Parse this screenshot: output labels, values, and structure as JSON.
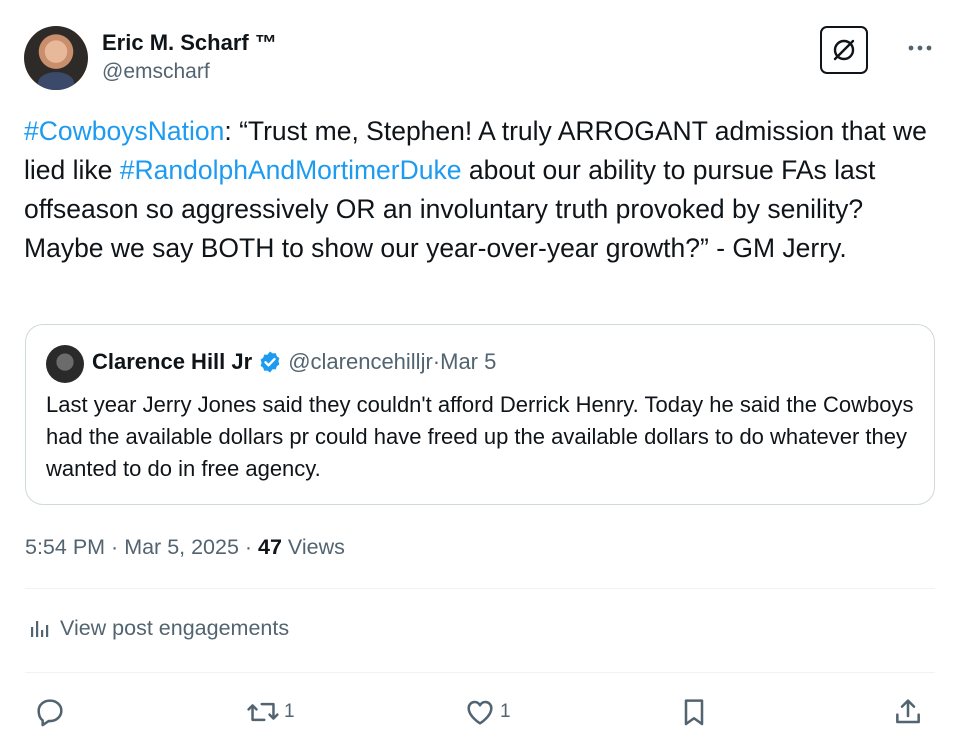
{
  "author": {
    "name": "Eric M. Scharf ™",
    "handle": "@emscharf"
  },
  "post": {
    "hashtag1": "#CowboysNation",
    "text1": ": “Trust me, Stephen! A truly ARROGANT admission that we lied like ",
    "hashtag2": "#RandolphAndMortimerDuke",
    "text2": " about our ability to pursue FAs last offseason so aggressively OR an involuntary truth provoked by senility? Maybe we say BOTH to show our year-over-year growth?” - GM Jerry."
  },
  "quote": {
    "name": "Clarence Hill Jr",
    "handle": "@clarencehilljr",
    "separator": " · ",
    "date": "Mar 5",
    "text": "Last year Jerry Jones said they couldn't afford Derrick Henry. Today he said the Cowboys had the available dollars pr could have freed up the available dollars to do whatever they wanted to do in free agency."
  },
  "meta": {
    "time": "5:54 PM",
    "sep1": " · ",
    "date": "Mar 5, 2025",
    "sep2": " · ",
    "views_count": "47",
    "views_label": " Views"
  },
  "engagements_label": "View post engagements",
  "actions": {
    "reply": {
      "icon": "reply-icon",
      "count": ""
    },
    "repost": {
      "icon": "repost-icon",
      "count": "1"
    },
    "like": {
      "icon": "heart-icon",
      "count": "1"
    },
    "bookmark": {
      "icon": "bookmark-icon",
      "count": ""
    },
    "share": {
      "icon": "share-icon",
      "count": ""
    }
  },
  "colors": {
    "text": "#0f1419",
    "secondary": "#536471",
    "link": "#1d9bf0",
    "border": "#cfd9de",
    "verified": "#1d9bf0"
  }
}
